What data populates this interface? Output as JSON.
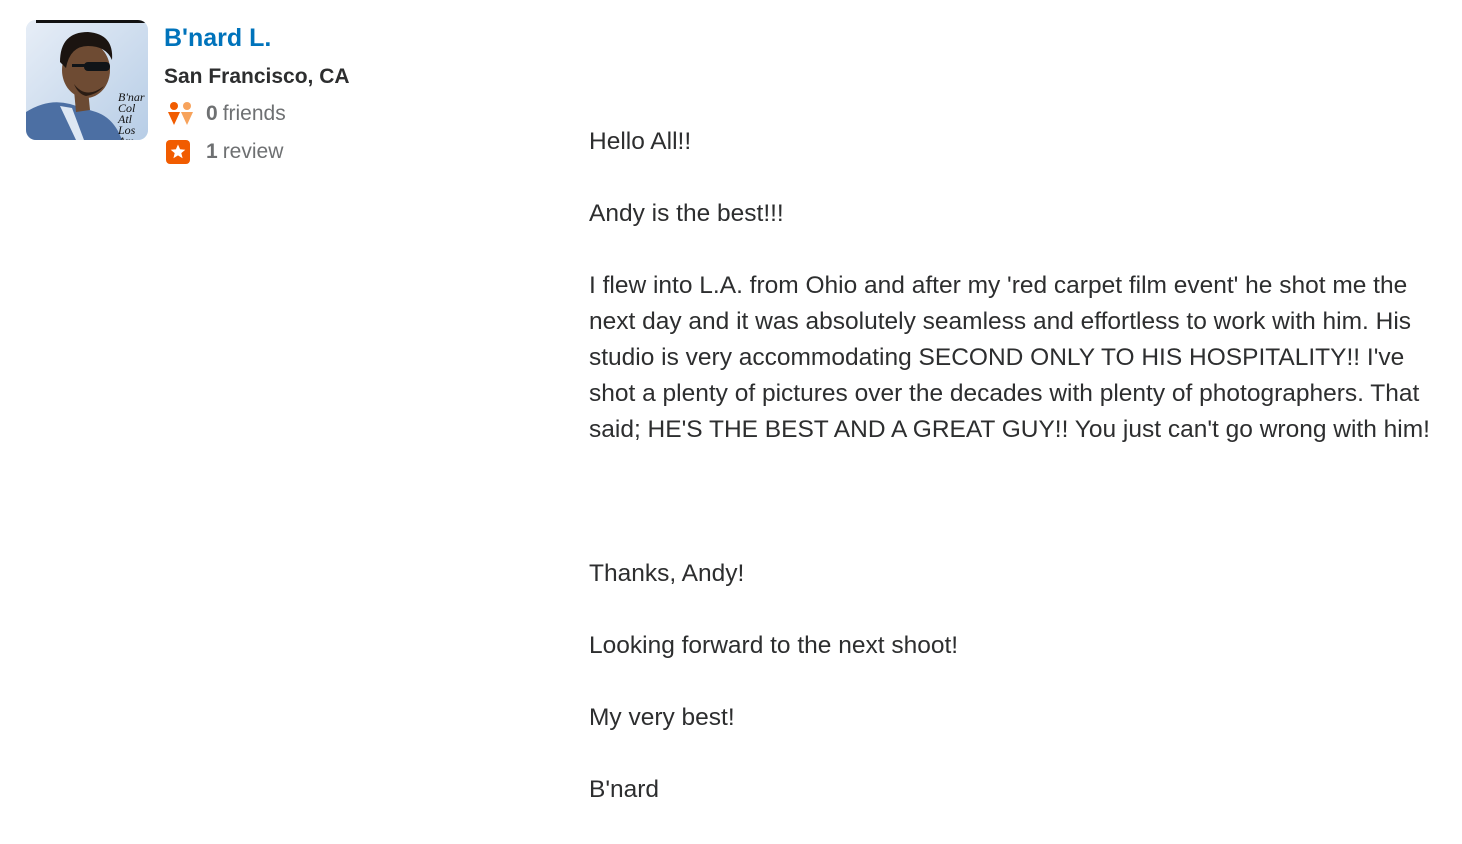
{
  "user": {
    "name": "B'nard L.",
    "location": "San Francisco, CA",
    "friends_count": "0",
    "friends_label": "friends",
    "reviews_count": "1",
    "reviews_label": "review",
    "avatar_overlay_text": "B'nar\nCol\nAtl\nLos\nAm"
  },
  "review": {
    "lines": [
      "Hello All!!",
      "Andy is the best!!!",
      "I flew into L.A. from Ohio and after my 'red carpet film event' he shot me the next day and it was absolutely seamless and effortless to work with him. His studio is very accommodating SECOND ONLY TO HIS HOSPITALITY!! I've shot a plenty of pictures over the decades with plenty of photographers. That said; HE'S THE BEST AND A GREAT GUY!! You just can't go wrong with him!",
      "",
      "Thanks, Andy!",
      "Looking forward to the next shoot!",
      "My very best!",
      "B'nard"
    ]
  },
  "colors": {
    "name_link": "#0073bb",
    "friends_icon": "#f15c00",
    "review_icon": "#f15c00"
  },
  "icons": {
    "friends": "friends-icon",
    "review": "star-icon"
  }
}
